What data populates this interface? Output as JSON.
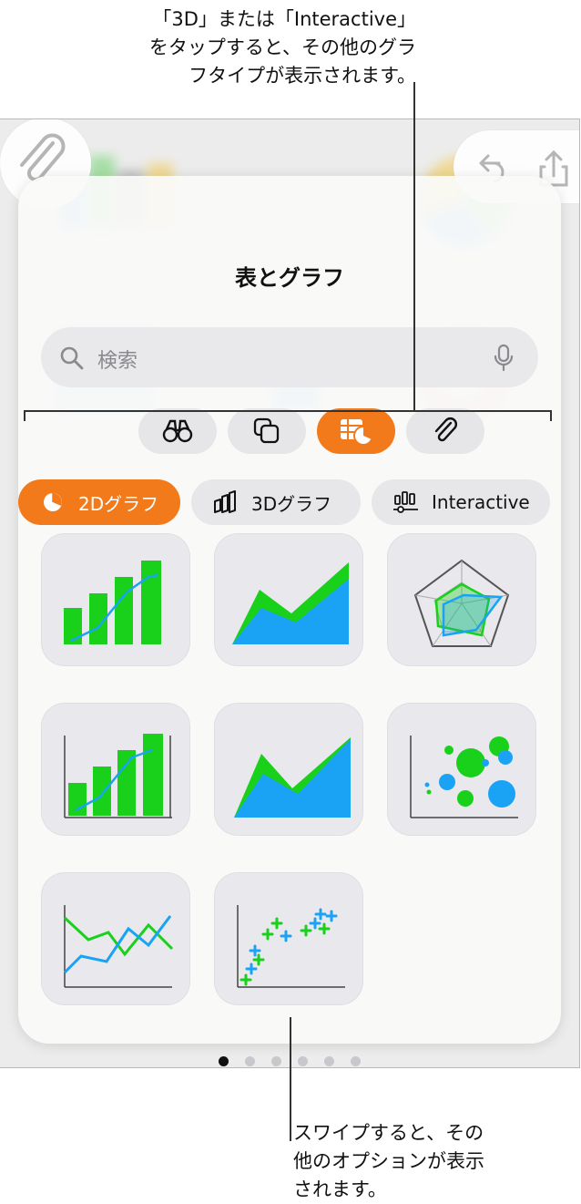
{
  "callouts": {
    "top": "「3D」または「Interactive」\nをタップすると、その他のグラ\nフタイプが表示されます。",
    "bottom": "スワイプすると、その\n他のオプションが表示\nされます。"
  },
  "panel": {
    "title": "表とグラフ",
    "search_placeholder": "検索"
  },
  "segments": [
    {
      "name": "binoculars-icon",
      "active": false
    },
    {
      "name": "shapes-icon",
      "active": false
    },
    {
      "name": "table-chart-icon",
      "active": true
    },
    {
      "name": "paperclip-icon",
      "active": false
    }
  ],
  "chart_tabs": [
    {
      "label": "2Dグラフ",
      "icon": "pie-icon",
      "active": true
    },
    {
      "label": "3Dグラフ",
      "icon": "3d-bar-icon",
      "active": false
    },
    {
      "label": "Interactive",
      "icon": "interactive-bar-icon",
      "active": false
    }
  ],
  "chart_types": [
    "column-chart",
    "area-chart",
    "radar-chart",
    "column-axes-chart",
    "area-axes-chart",
    "bubble-chart",
    "line-chart",
    "scatter-chart"
  ],
  "page_indicator": {
    "count": 6,
    "current": 1
  },
  "colors": {
    "accent": "#f27a1a",
    "green": "#19d01b",
    "blue": "#1aa3f5"
  }
}
